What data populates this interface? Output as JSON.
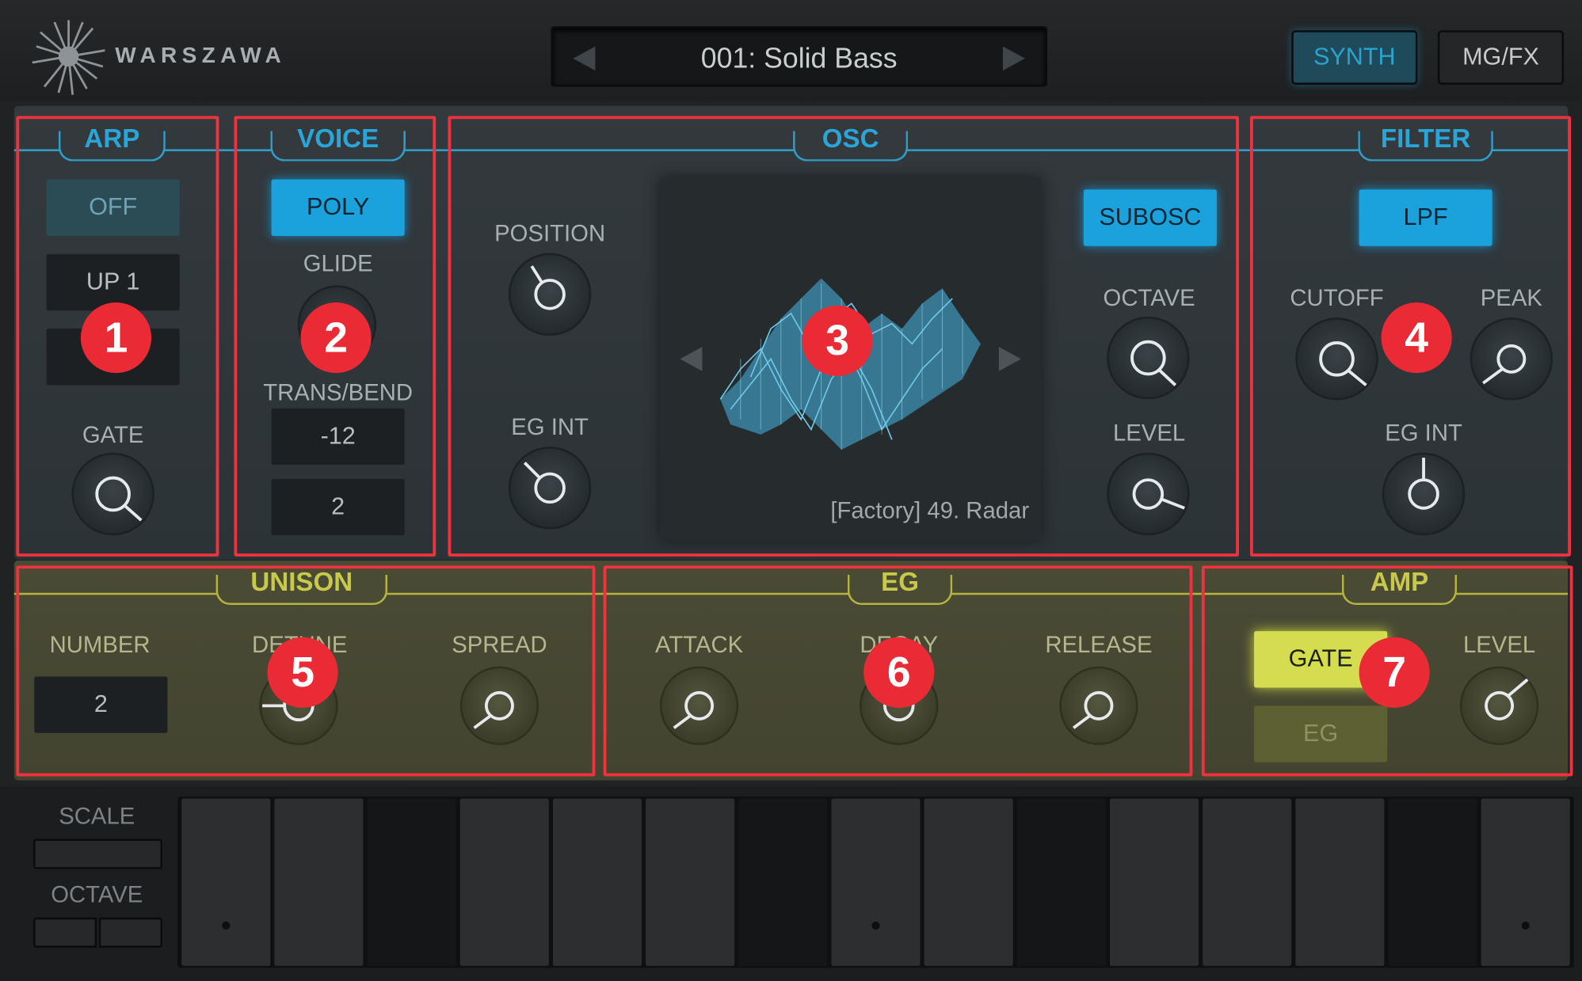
{
  "app": {
    "logo_text": "WARSZAWA"
  },
  "preset": {
    "name": "001: Solid Bass"
  },
  "top_buttons": {
    "synth": "SYNTH",
    "mgfx": "MG/FX"
  },
  "arp": {
    "title": "ARP",
    "off": "OFF",
    "up1": "UP 1",
    "blank": "",
    "gate": "GATE"
  },
  "voice": {
    "title": "VOICE",
    "poly": "POLY",
    "glide": "GLIDE",
    "trans_bend": "TRANS/BEND",
    "trans": "-12",
    "bend": "2"
  },
  "osc": {
    "title": "OSC",
    "position": "POSITION",
    "eg_int": "EG INT",
    "subosc": "SUBOSC",
    "octave": "OCTAVE",
    "level": "LEVEL",
    "wave_name": "[Factory] 49. Radar"
  },
  "filter": {
    "title": "FILTER",
    "lpf": "LPF",
    "cutoff": "CUTOFF",
    "peak": "PEAK",
    "eg_int": "EG INT"
  },
  "unison": {
    "title": "UNISON",
    "number": "NUMBER",
    "number_value": "2",
    "detune": "DETUNE",
    "spread": "SPREAD"
  },
  "eg": {
    "title": "EG",
    "attack": "ATTACK",
    "decay": "DECAY",
    "release": "RELEASE"
  },
  "amp": {
    "title": "AMP",
    "gate": "GATE",
    "eg": "EG",
    "level": "LEVEL"
  },
  "keyboard": {
    "scale": "SCALE",
    "octave": "OCTAVE"
  },
  "badges": {
    "b1": "1",
    "b2": "2",
    "b3": "3",
    "b4": "4",
    "b5": "5",
    "b6": "6",
    "b7": "7"
  },
  "colors": {
    "accent_blue": "#1ba1db",
    "accent_yellow": "#d6dc4f",
    "annotation_red": "#ea2b36"
  }
}
